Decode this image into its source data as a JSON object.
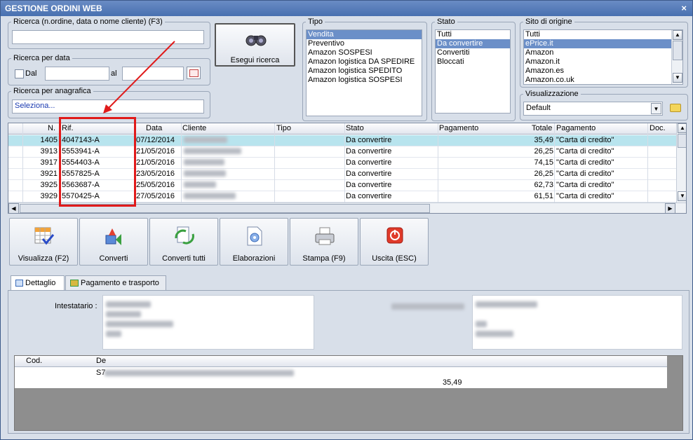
{
  "window": {
    "title": "GESTIONE ORDINI WEB",
    "close_label": "×"
  },
  "search": {
    "order_label": "Ricerca (n.ordine, data o nome cliente) (F3)",
    "order_value": "",
    "date_group_label": "Ricerca per data",
    "date_from_label": "Dal",
    "date_to_label": "al",
    "date_from_value": "",
    "date_to_value": "",
    "registry_label": "Ricerca per anagrafica",
    "registry_value": "Seleziona..."
  },
  "search_button": {
    "label": "Esegui ricerca"
  },
  "tipo": {
    "label": "Tipo",
    "items": [
      "Vendita",
      "Preventivo",
      "Amazon SOSPESI",
      "Amazon logistica DA SPEDIRE",
      "Amazon logistica SPEDITO",
      "Amazon logistica SOSPESI"
    ],
    "selected": 0
  },
  "stato": {
    "label": "Stato",
    "items": [
      "Tutti",
      "Da convertire",
      "Convertiti",
      "Bloccati"
    ],
    "selected": 1
  },
  "sito": {
    "label": "Sito di origine",
    "items": [
      "Tutti",
      "ePrice.it",
      "Amazon",
      "Amazon.it",
      "Amazon.es",
      "Amazon.co.uk"
    ],
    "selected": 1
  },
  "visualizzazione": {
    "label": "Visualizzazione",
    "value": "Default"
  },
  "grid": {
    "columns": [
      "N.",
      "Rif.",
      "Data",
      "Cliente",
      "Tipo",
      "Stato",
      "Pagamento",
      "Totale",
      "Pagamento",
      "Doc."
    ],
    "rows": [
      {
        "n": "1405",
        "rif": "4047143-A",
        "data": "07/12/2014",
        "stato": "Da convertire",
        "totale": "35,49",
        "pagamento": "\"Carta di credito\""
      },
      {
        "n": "3913",
        "rif": "5553941-A",
        "data": "21/05/2016",
        "stato": "Da convertire",
        "totale": "26,25",
        "pagamento": "\"Carta di credito\""
      },
      {
        "n": "3917",
        "rif": "5554403-A",
        "data": "21/05/2016",
        "stato": "Da convertire",
        "totale": "74,15",
        "pagamento": "\"Carta di credito\""
      },
      {
        "n": "3921",
        "rif": "5557825-A",
        "data": "23/05/2016",
        "stato": "Da convertire",
        "totale": "26,25",
        "pagamento": "\"Carta di credito\""
      },
      {
        "n": "3925",
        "rif": "5563687-A",
        "data": "25/05/2016",
        "stato": "Da convertire",
        "totale": "62,73",
        "pagamento": "\"Carta di credito\""
      },
      {
        "n": "3929",
        "rif": "5570425-A",
        "data": "27/05/2016",
        "stato": "Da convertire",
        "totale": "61,51",
        "pagamento": "\"Carta di credito\""
      }
    ]
  },
  "toolbar": [
    "Visualizza (F2)",
    "Converti",
    "Converti tutti",
    "Elaborazioni",
    "Stampa (F9)",
    "Uscita (ESC)"
  ],
  "tabs": [
    "Dettaglio",
    "Pagamento e trasporto"
  ],
  "detail": {
    "intestatario_label": "Intestatario :",
    "lines_columns": [
      "Cod.",
      "De"
    ],
    "line_code_prefix": "S7",
    "total_value": "35,49"
  },
  "colors": {
    "accent_red": "#e01a1a",
    "selection": "#6b8fc8",
    "row_highlight": "#b8e4ee"
  }
}
